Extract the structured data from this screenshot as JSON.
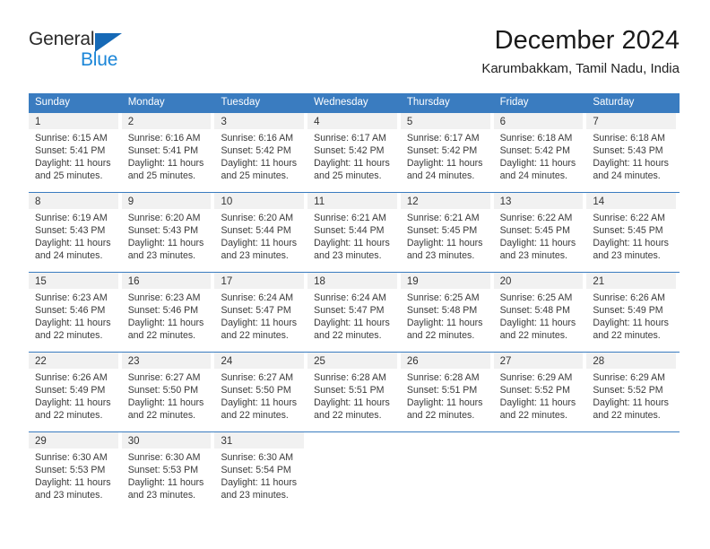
{
  "logo": {
    "word_top": "General",
    "word_bottom": "Blue",
    "triangle_color": "#1669b6",
    "blue_color": "#1b86d8"
  },
  "header": {
    "title": "December 2024",
    "location": "Karumbakkam, Tamil Nadu, India"
  },
  "theme": {
    "header_blue": "#3a7cc0",
    "day_band_gray": "#f1f1f1",
    "text": "#3a3a3a"
  },
  "weekdays": [
    "Sunday",
    "Monday",
    "Tuesday",
    "Wednesday",
    "Thursday",
    "Friday",
    "Saturday"
  ],
  "weeks": [
    [
      {
        "day": "1",
        "sunrise": "Sunrise: 6:15 AM",
        "sunset": "Sunset: 5:41 PM",
        "daylight": "Daylight: 11 hours and 25 minutes."
      },
      {
        "day": "2",
        "sunrise": "Sunrise: 6:16 AM",
        "sunset": "Sunset: 5:41 PM",
        "daylight": "Daylight: 11 hours and 25 minutes."
      },
      {
        "day": "3",
        "sunrise": "Sunrise: 6:16 AM",
        "sunset": "Sunset: 5:42 PM",
        "daylight": "Daylight: 11 hours and 25 minutes."
      },
      {
        "day": "4",
        "sunrise": "Sunrise: 6:17 AM",
        "sunset": "Sunset: 5:42 PM",
        "daylight": "Daylight: 11 hours and 25 minutes."
      },
      {
        "day": "5",
        "sunrise": "Sunrise: 6:17 AM",
        "sunset": "Sunset: 5:42 PM",
        "daylight": "Daylight: 11 hours and 24 minutes."
      },
      {
        "day": "6",
        "sunrise": "Sunrise: 6:18 AM",
        "sunset": "Sunset: 5:42 PM",
        "daylight": "Daylight: 11 hours and 24 minutes."
      },
      {
        "day": "7",
        "sunrise": "Sunrise: 6:18 AM",
        "sunset": "Sunset: 5:43 PM",
        "daylight": "Daylight: 11 hours and 24 minutes."
      }
    ],
    [
      {
        "day": "8",
        "sunrise": "Sunrise: 6:19 AM",
        "sunset": "Sunset: 5:43 PM",
        "daylight": "Daylight: 11 hours and 24 minutes."
      },
      {
        "day": "9",
        "sunrise": "Sunrise: 6:20 AM",
        "sunset": "Sunset: 5:43 PM",
        "daylight": "Daylight: 11 hours and 23 minutes."
      },
      {
        "day": "10",
        "sunrise": "Sunrise: 6:20 AM",
        "sunset": "Sunset: 5:44 PM",
        "daylight": "Daylight: 11 hours and 23 minutes."
      },
      {
        "day": "11",
        "sunrise": "Sunrise: 6:21 AM",
        "sunset": "Sunset: 5:44 PM",
        "daylight": "Daylight: 11 hours and 23 minutes."
      },
      {
        "day": "12",
        "sunrise": "Sunrise: 6:21 AM",
        "sunset": "Sunset: 5:45 PM",
        "daylight": "Daylight: 11 hours and 23 minutes."
      },
      {
        "day": "13",
        "sunrise": "Sunrise: 6:22 AM",
        "sunset": "Sunset: 5:45 PM",
        "daylight": "Daylight: 11 hours and 23 minutes."
      },
      {
        "day": "14",
        "sunrise": "Sunrise: 6:22 AM",
        "sunset": "Sunset: 5:45 PM",
        "daylight": "Daylight: 11 hours and 23 minutes."
      }
    ],
    [
      {
        "day": "15",
        "sunrise": "Sunrise: 6:23 AM",
        "sunset": "Sunset: 5:46 PM",
        "daylight": "Daylight: 11 hours and 22 minutes."
      },
      {
        "day": "16",
        "sunrise": "Sunrise: 6:23 AM",
        "sunset": "Sunset: 5:46 PM",
        "daylight": "Daylight: 11 hours and 22 minutes."
      },
      {
        "day": "17",
        "sunrise": "Sunrise: 6:24 AM",
        "sunset": "Sunset: 5:47 PM",
        "daylight": "Daylight: 11 hours and 22 minutes."
      },
      {
        "day": "18",
        "sunrise": "Sunrise: 6:24 AM",
        "sunset": "Sunset: 5:47 PM",
        "daylight": "Daylight: 11 hours and 22 minutes."
      },
      {
        "day": "19",
        "sunrise": "Sunrise: 6:25 AM",
        "sunset": "Sunset: 5:48 PM",
        "daylight": "Daylight: 11 hours and 22 minutes."
      },
      {
        "day": "20",
        "sunrise": "Sunrise: 6:25 AM",
        "sunset": "Sunset: 5:48 PM",
        "daylight": "Daylight: 11 hours and 22 minutes."
      },
      {
        "day": "21",
        "sunrise": "Sunrise: 6:26 AM",
        "sunset": "Sunset: 5:49 PM",
        "daylight": "Daylight: 11 hours and 22 minutes."
      }
    ],
    [
      {
        "day": "22",
        "sunrise": "Sunrise: 6:26 AM",
        "sunset": "Sunset: 5:49 PM",
        "daylight": "Daylight: 11 hours and 22 minutes."
      },
      {
        "day": "23",
        "sunrise": "Sunrise: 6:27 AM",
        "sunset": "Sunset: 5:50 PM",
        "daylight": "Daylight: 11 hours and 22 minutes."
      },
      {
        "day": "24",
        "sunrise": "Sunrise: 6:27 AM",
        "sunset": "Sunset: 5:50 PM",
        "daylight": "Daylight: 11 hours and 22 minutes."
      },
      {
        "day": "25",
        "sunrise": "Sunrise: 6:28 AM",
        "sunset": "Sunset: 5:51 PM",
        "daylight": "Daylight: 11 hours and 22 minutes."
      },
      {
        "day": "26",
        "sunrise": "Sunrise: 6:28 AM",
        "sunset": "Sunset: 5:51 PM",
        "daylight": "Daylight: 11 hours and 22 minutes."
      },
      {
        "day": "27",
        "sunrise": "Sunrise: 6:29 AM",
        "sunset": "Sunset: 5:52 PM",
        "daylight": "Daylight: 11 hours and 22 minutes."
      },
      {
        "day": "28",
        "sunrise": "Sunrise: 6:29 AM",
        "sunset": "Sunset: 5:52 PM",
        "daylight": "Daylight: 11 hours and 22 minutes."
      }
    ],
    [
      {
        "day": "29",
        "sunrise": "Sunrise: 6:30 AM",
        "sunset": "Sunset: 5:53 PM",
        "daylight": "Daylight: 11 hours and 23 minutes."
      },
      {
        "day": "30",
        "sunrise": "Sunrise: 6:30 AM",
        "sunset": "Sunset: 5:53 PM",
        "daylight": "Daylight: 11 hours and 23 minutes."
      },
      {
        "day": "31",
        "sunrise": "Sunrise: 6:30 AM",
        "sunset": "Sunset: 5:54 PM",
        "daylight": "Daylight: 11 hours and 23 minutes."
      },
      {
        "day": "",
        "sunrise": "",
        "sunset": "",
        "daylight": ""
      },
      {
        "day": "",
        "sunrise": "",
        "sunset": "",
        "daylight": ""
      },
      {
        "day": "",
        "sunrise": "",
        "sunset": "",
        "daylight": ""
      },
      {
        "day": "",
        "sunrise": "",
        "sunset": "",
        "daylight": ""
      }
    ]
  ]
}
